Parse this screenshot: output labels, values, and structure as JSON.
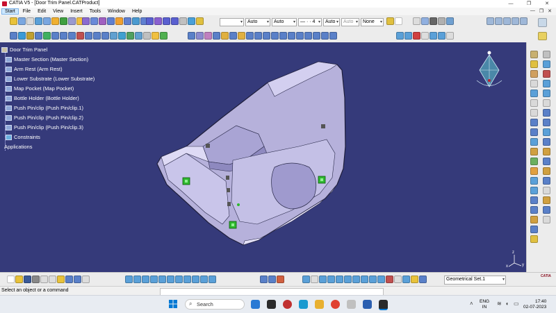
{
  "window": {
    "title": "CATIA V5 - [Door Trim Panel.CATProduct]",
    "controls": [
      "—",
      "❐",
      "✕"
    ]
  },
  "menu": {
    "items": [
      "Start",
      "File",
      "Edit",
      "View",
      "Insert",
      "Tools",
      "Window",
      "Help"
    ],
    "active": "Start",
    "doc_controls": [
      "—",
      "❐",
      "✕"
    ]
  },
  "toolbar": {
    "combos": [
      {
        "value": "",
        "name": "color"
      },
      {
        "value": "Auto",
        "name": "transparency"
      },
      {
        "value": "Auto",
        "name": "line-thickness"
      },
      {
        "value": "—  ·  ·  4",
        "name": "linetype"
      },
      {
        "value": "Auto",
        "name": "layer"
      },
      {
        "value": "Auto",
        "name": "render-style"
      },
      {
        "value": "None",
        "name": "layer-filter"
      }
    ]
  },
  "tree": {
    "root": "Door Trim Panel",
    "items": [
      "Master Section (Master Section)",
      "Arm Rest (Arm Rest)",
      "Lower Substrate (Lower Substrate)",
      "Map Pocket (Map Pocket)",
      "Bottle Holder (Bottle Holder)",
      "Push Pin/clip (Push Pin/clip.1)",
      "Push Pin/clip (Push Pin/clip.2)",
      "Push Pin/clip (Push Pin/clip.3)",
      "Constraints",
      "Applications"
    ]
  },
  "viewport": {
    "background": "#353a7a",
    "part_color": "#b9b4dc",
    "clip_color": "#2fb82f",
    "axis_labels": {
      "x": "x",
      "y": "y",
      "z": "z"
    }
  },
  "bottom": {
    "geometrical_set": "Geometrical Set.1",
    "brand": "CATIA"
  },
  "status": {
    "message": "Select an object or a command"
  },
  "taskbar": {
    "search_placeholder": "Search",
    "lang_top": "ENG",
    "lang_bottom": "IN",
    "time": "17:40",
    "date": "02-07-2023"
  }
}
